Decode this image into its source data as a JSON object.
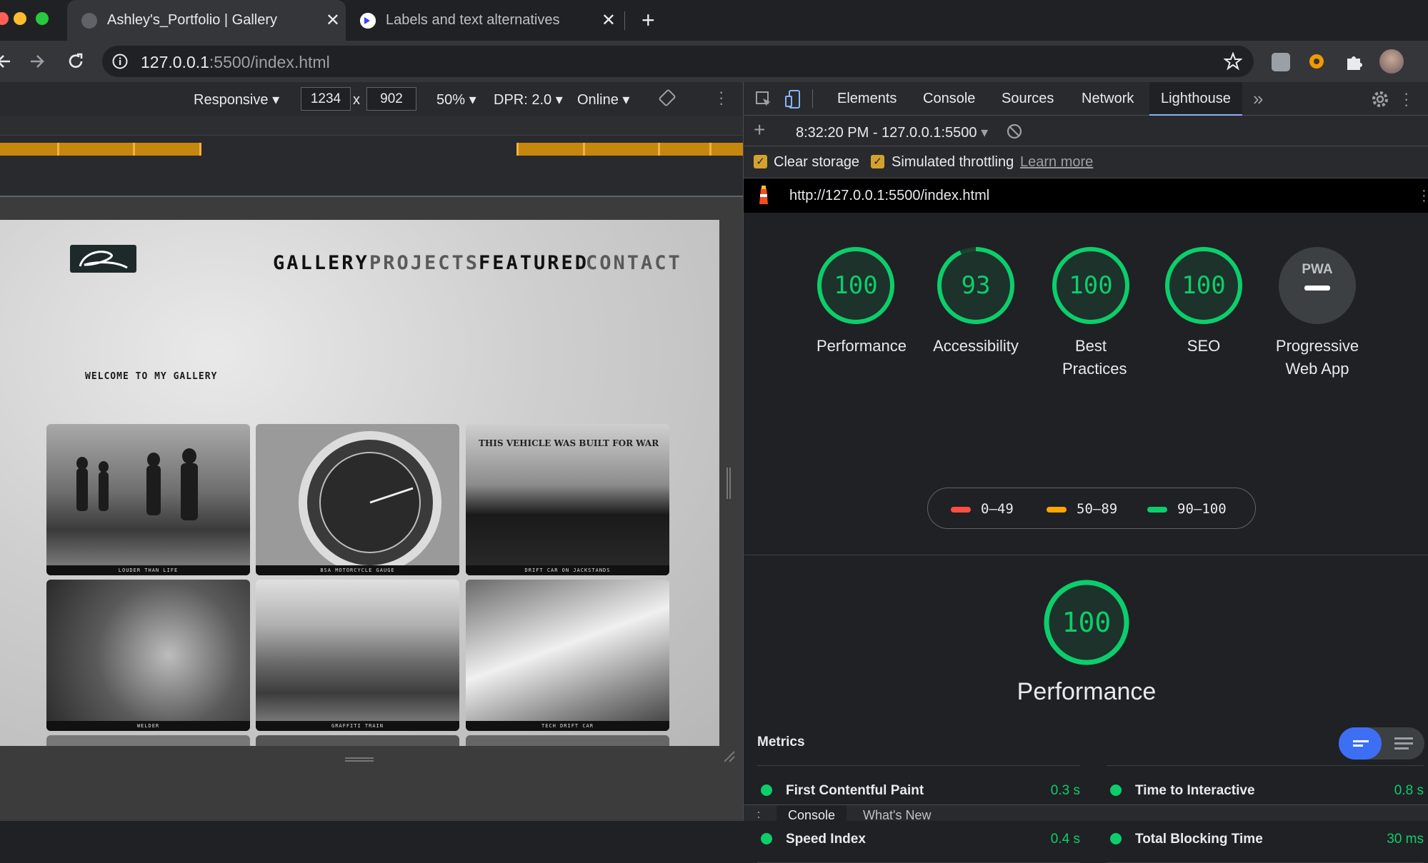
{
  "colors": {
    "pass": "#0cce6b",
    "average": "#ffa400",
    "fail": "#ff4e42",
    "accent": "#8ab4f8"
  },
  "browser": {
    "tabs": [
      {
        "title": "Ashley's_Portfolio | Gallery",
        "icon": "globe-icon",
        "active": true
      },
      {
        "title": "Labels and text alternatives",
        "icon": "web-dev-icon",
        "active": false
      }
    ],
    "new_tab": "+",
    "close_glyph": "✕",
    "address": {
      "host": "127.0.0.1",
      "path": ":5500/index.html"
    }
  },
  "device_toolbar": {
    "mode": "Responsive",
    "width": "1234",
    "times": "x",
    "height": "902",
    "zoom": "50%",
    "dpr": "DPR: 2.0",
    "network": "Online"
  },
  "site": {
    "nav": [
      "GALLERY",
      "PROJECTS",
      "FEATURED",
      "CONTACT"
    ],
    "welcome": "WELCOME TO MY GALLERY",
    "photos": [
      {
        "caption": "LOUDER THAN LIFE"
      },
      {
        "caption": "BSA MOTORCYCLE GAUGE"
      },
      {
        "caption": "DRIFT CAR ON JACKSTANDS"
      },
      {
        "caption": "WELDER"
      },
      {
        "caption": "GRAFFITI TRAIN"
      },
      {
        "caption": "TECH DRIFT CAR"
      }
    ],
    "photo3_banner": "THIS VEHICLE WAS BUILT FOR WAR"
  },
  "devtools": {
    "tabs": [
      "Elements",
      "Console",
      "Sources",
      "Network",
      "Lighthouse"
    ],
    "active_tab": "Lighthouse",
    "more": "»",
    "report_selector": "8:32:20 PM - 127.0.0.1:5500",
    "clear_storage": "Clear storage",
    "throttling": "Simulated throttling",
    "learn_more": "Learn more",
    "report_url": "http://127.0.0.1:5500/index.html",
    "drawer_tabs": [
      "Console",
      "What's New"
    ]
  },
  "lighthouse": {
    "scores": [
      {
        "label": "Performance",
        "score": 100
      },
      {
        "label": "Accessibility",
        "score": 93
      },
      {
        "label": "Best Practices",
        "score": 100
      },
      {
        "label": "SEO",
        "score": 100
      },
      {
        "label": "Progressive Web App",
        "badge": "PWA"
      }
    ],
    "legend": [
      "0–49",
      "50–89",
      "90–100"
    ],
    "performance_title": "Performance",
    "performance_score": "100",
    "metrics_title": "Metrics",
    "metrics": [
      {
        "name": "First Contentful Paint",
        "value": "0.3 s"
      },
      {
        "name": "Time to Interactive",
        "value": "0.8 s"
      },
      {
        "name": "Speed Index",
        "value": "0.4 s"
      },
      {
        "name": "Total Blocking Time",
        "value": "30 ms"
      }
    ]
  }
}
